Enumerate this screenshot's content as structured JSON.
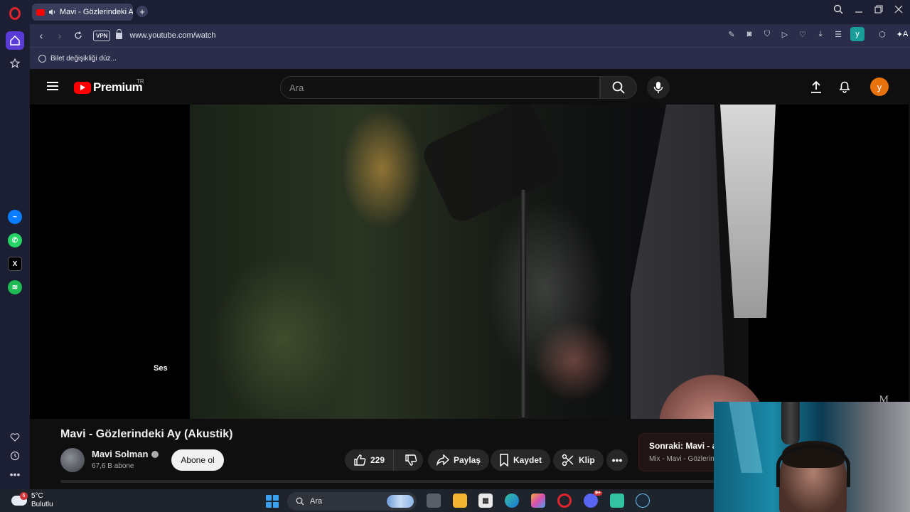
{
  "browser": {
    "tab_title": "Mavi - Gözlerindeki A",
    "new_tab_label": "+",
    "url": "www.youtube.com/watch",
    "vpn_label": "VPN",
    "extension_label": "y",
    "ai_label": "A",
    "bookmark_label": "Bilet değişikliği düz..."
  },
  "youtube": {
    "brand": "Premium",
    "region": "TR",
    "search_placeholder": "Ara",
    "avatar_letter": "y",
    "video_caption": "Ses",
    "video_watermark": "M",
    "video_title": "Mavi - Gözlerindeki Ay (Akustik)",
    "channel_name": "Mavi Solman",
    "subscribers": "67,6 B abone",
    "subscribe_label": "Abone ol",
    "like_count": "229",
    "share_label": "Paylaş",
    "save_label": "Kaydet",
    "clip_label": "Klip",
    "next_title": "Sonraki: Mavi - as",
    "next_subtitle": "Mix - Mavi - Gözlerindeki"
  },
  "taskbar": {
    "temperature": "5°C",
    "weather": "Bulutlu",
    "weather_badge": "6",
    "search_label": "Ara",
    "discord_badge": "9+"
  },
  "colors": {
    "youtube_red": "#ff0000",
    "opera_red": "#e0242c",
    "avatar_orange": "#e8730c",
    "sidebar_bg": "#1c1e33"
  }
}
